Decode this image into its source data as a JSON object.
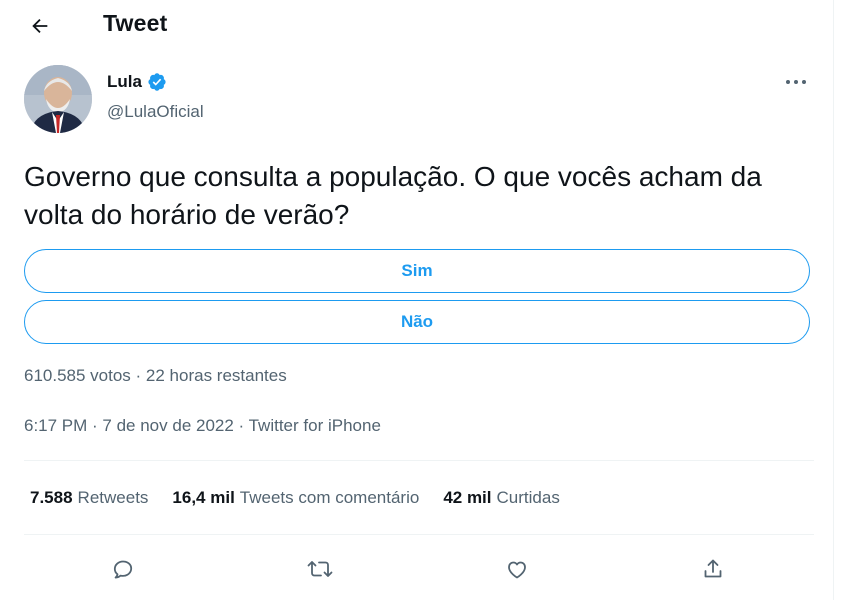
{
  "header": {
    "title": "Tweet",
    "back_icon": "arrow-left-icon"
  },
  "author": {
    "name": "Lula",
    "handle": "@LulaOficial",
    "verified_icon": "verified-badge-icon",
    "verified_color": "#1d9bf0"
  },
  "tweet": {
    "text": "Governo que consulta a população. O que vocês acham da volta do horário de verão?"
  },
  "poll": {
    "options": [
      {
        "label": "Sim"
      },
      {
        "label": "Não"
      }
    ],
    "meta": "610.585 votos · 22 horas restantes"
  },
  "timestamp": "6:17 PM · 7 de nov de 2022 · Twitter for iPhone",
  "stats": [
    {
      "num": "7.588",
      "label": "Retweets"
    },
    {
      "num": "16,4 mil",
      "label": "Tweets com comentário"
    },
    {
      "num": "42 mil",
      "label": "Curtidas"
    }
  ],
  "actions": [
    {
      "icon": "reply-icon"
    },
    {
      "icon": "retweet-icon"
    },
    {
      "icon": "like-icon"
    },
    {
      "icon": "share-icon"
    }
  ],
  "colors": {
    "accent": "#1d9bf0",
    "muted": "#536471",
    "text": "#0f1419"
  }
}
